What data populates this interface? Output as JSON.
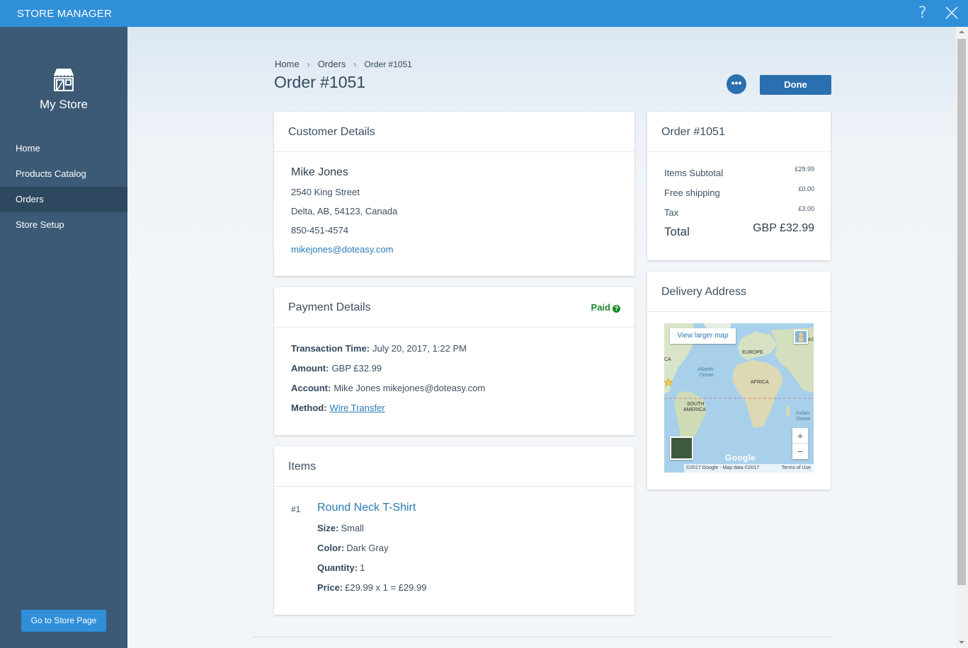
{
  "app": {
    "title": "STORE MANAGER",
    "help_label": "?"
  },
  "sidebar": {
    "store_name": "My Store",
    "items": [
      {
        "label": "Home",
        "active": false
      },
      {
        "label": "Products Catalog",
        "active": false
      },
      {
        "label": "Orders",
        "active": true
      },
      {
        "label": "Store Setup",
        "active": false
      }
    ],
    "store_button": "Go to Store Page"
  },
  "header": {
    "breadcrumb": [
      "Home",
      "Orders",
      "Order #1051"
    ],
    "title": "Order #1051",
    "more_label": "•••",
    "done_label": "Done"
  },
  "customer": {
    "heading": "Customer Details",
    "name": "Mike Jones",
    "street": "2540 King Street",
    "city": "Delta, AB, 54123, Canada",
    "phone": "850-451-4574",
    "email": "mikejones@doteasy.com"
  },
  "payment": {
    "heading": "Payment Details",
    "status": "Paid",
    "status_icon": "?",
    "transaction_label": "Transaction Time:",
    "transaction_value": "July 20, 2017, 1:22 PM",
    "amount_label": "Amount:",
    "amount_value": "GBP £32.99",
    "account_label": "Account:",
    "account_value": "Mike Jones mikejones@doteasy.com",
    "method_label": "Method:",
    "method_value": "Wire Transfer"
  },
  "items": {
    "heading": "Items",
    "list": [
      {
        "number": "#1",
        "name": "Round Neck T-Shirt",
        "size_label": "Size:",
        "size": "Small",
        "color_label": "Color:",
        "color": "Dark Gray",
        "quantity_label": "Quantity:",
        "quantity": "1",
        "price_label": "Price:",
        "price": "£29.99 x 1 = £29.99"
      }
    ]
  },
  "summary": {
    "heading": "Order #1051",
    "subtotal_label": "Items Subtotal",
    "subtotal": "£29.99",
    "shipping_label": "Free shipping",
    "shipping": "£0.00",
    "tax_label": "Tax",
    "tax": "£3.00",
    "total_label": "Total",
    "total": "GBP £32.99"
  },
  "delivery": {
    "heading": "Delivery Address",
    "map": {
      "larger_map": "View larger map",
      "zoom_in": "+",
      "zoom_out": "−",
      "google": "Google",
      "attribution": "©2017 Google - Map data ©2017",
      "terms": "Terms of Use",
      "labels": {
        "europe": "EUROPE",
        "africa": "AFRICA",
        "atlantic": "Atlantic",
        "ocean1": "Ocean",
        "south": "SOUTH",
        "america": "AMERICA",
        "indian": "Indian",
        "ocean2": "Ocean",
        "ca": "CA",
        "as": "AS"
      }
    }
  },
  "colors": {
    "topbar": "#2f8fd8",
    "sidebar": "#3c5a76",
    "sidebar_active": "#2e4860",
    "primary_button": "#2a70b0",
    "link": "#2a7ab5",
    "paid": "#1a8a2b"
  }
}
